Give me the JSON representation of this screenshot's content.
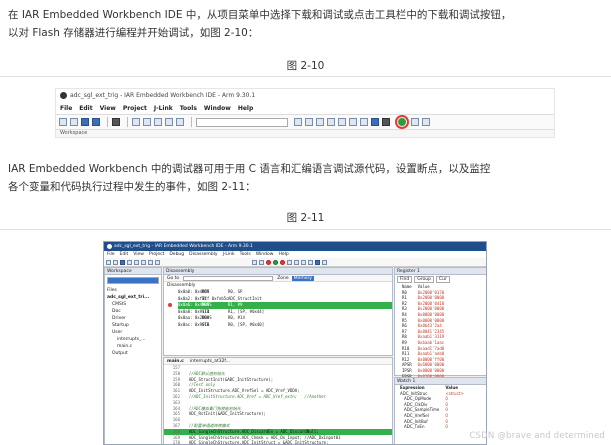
{
  "paragraph1": {
    "line1": "在 IAR Embedded Workbench IDE 中，从项目菜单中选择下载和调试或点击工具栏中的下载和调试按钮，",
    "line2": "以对 Flash 存储器进行编程并开始调试，如图 2-10："
  },
  "figure1": {
    "caption": "图 2-10",
    "window_title": "adc_sgl_ext_trig - IAR Embedded Workbench IDE - Arm 9.30.1",
    "menu": [
      "File",
      "Edit",
      "View",
      "Project",
      "J-Link",
      "Tools",
      "Window",
      "Help"
    ],
    "workspace_label": "Workspace"
  },
  "paragraph2": {
    "line1": "IAR Embedded Workbench 中的调试器可用于用 C 语言和汇编语言调试源代码，设置断点，以及监控",
    "line2": "各个变量和代码执行过程中发生的事件，如图 2-11："
  },
  "figure2": {
    "caption": "图 2-11",
    "window_title": "adc_sgl_ext_trig - IAR Embedded Workbench IDE - Arm 9.30.1",
    "menu": [
      "File",
      "Edit",
      "View",
      "Project",
      "Debug",
      "Disassembly",
      "J-Link",
      "Tools",
      "Window",
      "Help"
    ],
    "workspace": {
      "title": "Workspace",
      "header_files": "Files",
      "tree": [
        "adc_sgl_ext_tri...",
        "CMSIS",
        "Doc",
        "Driver",
        "Startup",
        "User",
        "interrupts_...",
        "main.c",
        "Output"
      ]
    },
    "disassembly": {
      "title": "Disassembly",
      "go_to": "Go to",
      "zone_label": "Zone",
      "zone_value": "Memory",
      "pane_label": "Disassembly",
      "rows": [
        {
          "addr": "0x0a0: 0x4669",
          "op": "MOV",
          "arg": "R0, SP"
        },
        {
          "addr": "0x0a2: 0xf7ff 0xfeb5c",
          "op": "BL",
          "arg": "ADC_StructInit"
        },
        {
          "addr": "",
          "op": "",
          "arg": ""
        },
        {
          "addr": "0x0a6: 0x4909",
          "op": "MOVS",
          "arg": "R1, #9"
        },
        {
          "addr": "0x0a8: 0x9111",
          "op": "STR",
          "arg": "R1, [SP, #0x44]"
        },
        {
          "addr": "",
          "op": "",
          "arg": ""
        },
        {
          "addr": "0x0aa: 0x200e",
          "op": "MOVS",
          "arg": "R0, #14"
        },
        {
          "addr": "0x0ac: 0x9010",
          "op": "STR",
          "arg": "R0, [SP, #0x40]"
        }
      ]
    },
    "editor": {
      "tabs": [
        "main.c",
        "interrupts_at32f..."
      ],
      "lines": [
        {
          "n": "157",
          "t": "",
          "cls": ""
        },
        {
          "n": "158",
          "t": "  //ADC默认值初始化",
          "cls": "c"
        },
        {
          "n": "159",
          "t": "  ADC_StructInit(&ADC_InitStructure);",
          "cls": ""
        },
        {
          "n": "160",
          "t": "  //Test only",
          "cls": "c"
        },
        {
          "n": "161",
          "t": "  ADC_InitStructure.ADC_VrefSel = ADC_Vref_VDDA;",
          "cls": ""
        },
        {
          "n": "162",
          "t": "  //ADC_InitStructure.ADC_Vref = ADC_Vref_extn;   //Another",
          "cls": "c"
        },
        {
          "n": "163",
          "t": "",
          "cls": ""
        },
        {
          "n": "164",
          "t": "  //ADC模拟看门狗使能初始化",
          "cls": "c"
        },
        {
          "n": "165",
          "t": "  ADC_RstInit(&ADC_InitStructure);",
          "cls": ""
        },
        {
          "n": "166",
          "t": "",
          "cls": ""
        },
        {
          "n": "167",
          "t": "  //配置单通道转换模式",
          "cls": "c"
        },
        {
          "n": "168",
          "t": "  ADC_SingleChStructure.ADC_DiscardEn = ADC_DiscardNull;",
          "cls": "hl"
        },
        {
          "n": "169",
          "t": "  ADC_SingleChStructure.ADC_Chmsk = ADC_Dx_Input; //ADC_DxInput01",
          "cls": ""
        },
        {
          "n": "170",
          "t": "  ADC_SingleChStructure.ADC_InitStruct = &ADC_InitStructure;",
          "cls": ""
        }
      ]
    },
    "registers": {
      "title": "Register 1",
      "find_label": "Find",
      "group_label": "Group",
      "group_value": "Cur",
      "col_name": "Name",
      "col_value": "Value",
      "rows": [
        {
          "n": "R0",
          "v": "0x2000'0170"
        },
        {
          "n": "R1",
          "v": "0x2000'0000"
        },
        {
          "n": "R2",
          "v": "0x2000'0418"
        },
        {
          "n": "R3",
          "v": "0x2000'0000"
        },
        {
          "n": "R4",
          "v": "0x0000'0000"
        },
        {
          "n": "R5",
          "v": "0x0000'0000"
        },
        {
          "n": "R6",
          "v": "0x0b43'2a4"
        },
        {
          "n": "R7",
          "v": "0x8041'2345"
        },
        {
          "n": "R8",
          "v": "0xaab1'3119"
        },
        {
          "n": "R9",
          "v": "0xbaab'1aac"
        },
        {
          "n": "R10",
          "v": "0xaad1'7ad0"
        },
        {
          "n": "R11",
          "v": "0xaab1'aeb0"
        },
        {
          "n": "R12",
          "v": "0x0000'ff00"
        },
        {
          "n": "APSR",
          "v": "0x6000'0000"
        },
        {
          "n": "IPSR",
          "v": "0x0000'0000"
        },
        {
          "n": "EPSR",
          "v": "0x0100'0000"
        }
      ]
    },
    "watch": {
      "title": "Watch 1",
      "col_expression": "Expression",
      "col_value": "Value",
      "rows": [
        {
          "e": "ADC_InitStruc",
          "v": "<struct>"
        },
        {
          "e": "ADC_OpMode",
          "v": "0"
        },
        {
          "e": "ADC_ClkDiv",
          "v": "0"
        },
        {
          "e": "ADC_SampleTime",
          "v": "0"
        },
        {
          "e": "ADC_VrefSel",
          "v": "0"
        },
        {
          "e": "ADC_InitBuf",
          "v": "0"
        },
        {
          "e": "ADC_TxEn",
          "v": "0"
        }
      ]
    }
  },
  "watermark": "CSDN @brave and determined"
}
